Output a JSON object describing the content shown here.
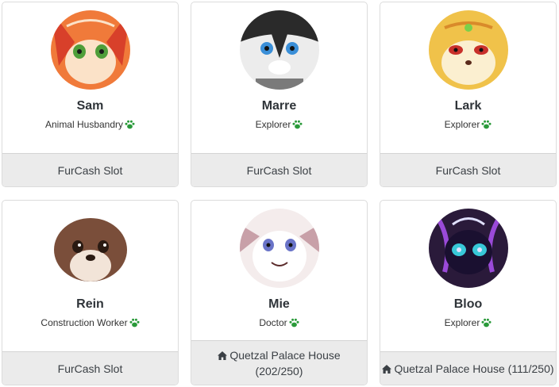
{
  "characters": [
    {
      "name": "Sam",
      "job": "Animal Husbandry",
      "footer_line1": "FurCash Slot",
      "footer_line2": "",
      "footer_home": false,
      "palette": [
        "#f07a3a",
        "#fbe2c8",
        "#d8402a",
        "#4f9e3a"
      ]
    },
    {
      "name": "Marre",
      "job": "Explorer",
      "footer_line1": "FurCash Slot",
      "footer_line2": "",
      "footer_home": false,
      "palette": [
        "#ececec",
        "#2a2a2a",
        "#7a7a7a",
        "#3a8fd8"
      ]
    },
    {
      "name": "Lark",
      "job": "Explorer",
      "footer_line1": "FurCash Slot",
      "footer_line2": "",
      "footer_home": false,
      "palette": [
        "#f0c24a",
        "#fbefd0",
        "#d98a2a",
        "#c8302a"
      ]
    },
    {
      "name": "Rein",
      "job": "Construction Worker",
      "footer_line1": "FurCash Slot",
      "footer_line2": "",
      "footer_home": false,
      "palette": [
        "#7a4e3a",
        "#f2e4d8",
        "#5a3526",
        "#2a1a12"
      ]
    },
    {
      "name": "Mie",
      "job": "Doctor",
      "footer_line1": "Quetzal Palace House",
      "footer_line2": "(202/250)",
      "footer_home": true,
      "palette": [
        "#f4ecec",
        "#ffffff",
        "#c8a0a8",
        "#6a74c8"
      ]
    },
    {
      "name": "Bloo",
      "job": "Explorer",
      "footer_line1": "Quetzal Palace House (111/250)",
      "footer_line2": "",
      "footer_home": true,
      "palette": [
        "#2a1a3a",
        "#9a4ad8",
        "#38c8d8",
        "#e0e0ff"
      ]
    }
  ],
  "icons": {
    "job_icon": "paw-icon",
    "house_icon": "home-icon"
  },
  "colors": {
    "paw": "#2a9a3a",
    "footer_bg": "#ebebeb",
    "border": "#dcdcdc"
  }
}
